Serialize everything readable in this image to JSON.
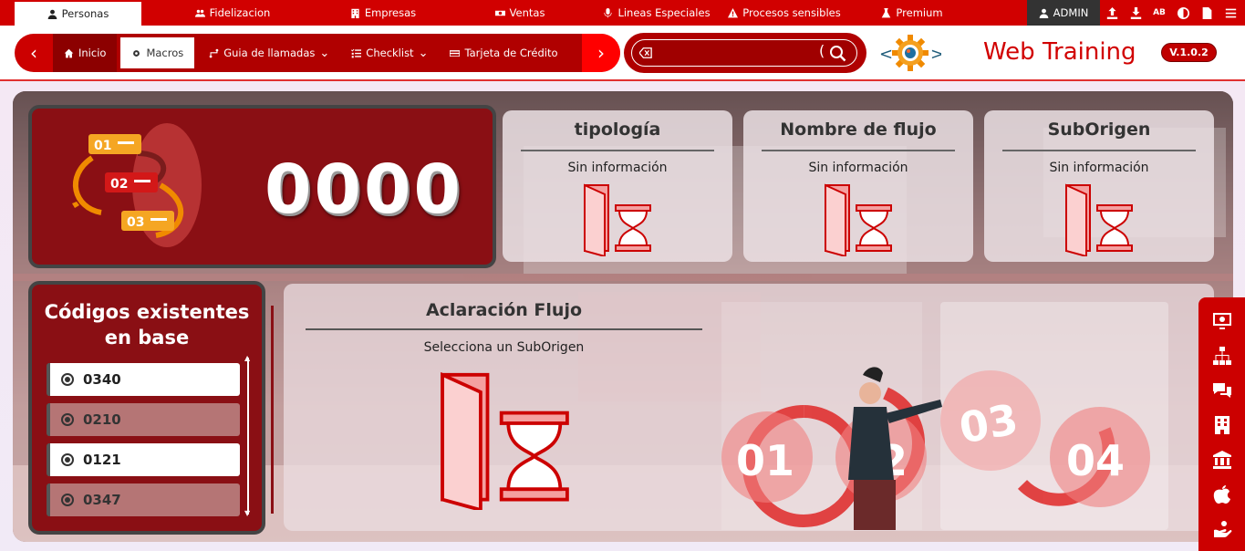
{
  "topnav": {
    "items": [
      {
        "label": "Personas",
        "active": true
      },
      {
        "label": "Fidelizacion"
      },
      {
        "label": "Empresas"
      },
      {
        "label": "Ventas"
      },
      {
        "label": "Lineas Especiales"
      },
      {
        "label": "Procesos sensibles"
      },
      {
        "label": "Premium"
      }
    ],
    "user": "ADMIN",
    "tools": [
      "upload-icon",
      "download-icon",
      "spellcheck-icon",
      "contrast-icon",
      "document-icon",
      "menu-icon"
    ],
    "spellcheck_label": "AB"
  },
  "secnav": {
    "items": [
      {
        "label": "Inicio"
      },
      {
        "label": "Macros",
        "active": true
      },
      {
        "label": "Guia de llamadas"
      },
      {
        "label": "Checklist"
      },
      {
        "label": "Tarjeta de Crédito"
      }
    ]
  },
  "search": {
    "value": "",
    "placeholder": ""
  },
  "brand": {
    "title": "Web Training",
    "version": "V.1.0.2"
  },
  "counter": {
    "value": "0000",
    "steps": [
      "01",
      "02",
      "03"
    ]
  },
  "info_cards": [
    {
      "title": "tipología",
      "value": "Sin información"
    },
    {
      "title": "Nombre de flujo",
      "value": "Sin información"
    },
    {
      "title": "SubOrigen",
      "value": "Sin información"
    }
  ],
  "codes": {
    "title": "Códigos existentes en base",
    "items": [
      "0340",
      "0210",
      "0121",
      "0347"
    ]
  },
  "aclaracion": {
    "title": "Aclaración Flujo",
    "subtitle": "Selecciona un SubOrigen",
    "steps": [
      "01",
      "02",
      "03",
      "04"
    ]
  },
  "sidebar": {
    "icons": [
      "monitor-icon",
      "org-chart-icon",
      "chat-icon",
      "building-icon",
      "bank-icon",
      "apple-icon",
      "hand-icon"
    ]
  },
  "colors": {
    "primary": "#d10000",
    "dark": "#8a0f14",
    "admin_bg": "#333333"
  }
}
